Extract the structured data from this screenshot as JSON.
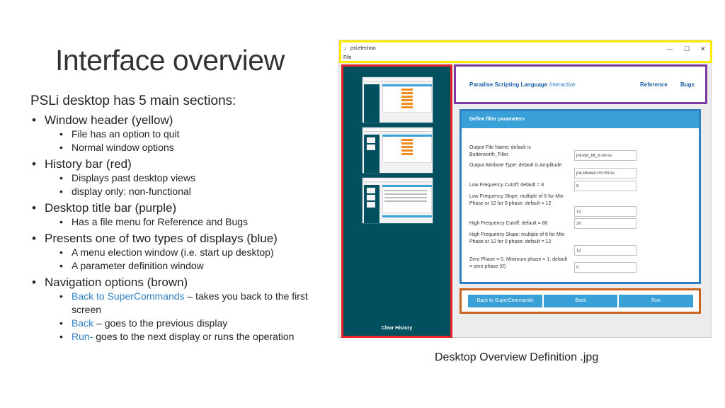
{
  "slide": {
    "title": "Interface overview",
    "intro": "PSLi desktop has 5 main sections:",
    "sections": [
      {
        "label": "Window header (yellow)",
        "items": [
          "File has an option to quit",
          "Normal window options"
        ]
      },
      {
        "label": "History bar (red)",
        "items": [
          "Displays past desktop views",
          "display only: non-functional"
        ]
      },
      {
        "label": "Desktop title bar (purple)",
        "items": [
          "Has a file menu for Reference and Bugs"
        ]
      },
      {
        "label": "Presents one of two types of displays (blue)",
        "items": [
          "A menu election window (i.e. start up desktop)",
          "A parameter definition window"
        ]
      },
      {
        "label": "Navigation options (brown)",
        "nav_items": [
          {
            "link": "Back to SuperCommands",
            "rest": " – takes you back to the first screen"
          },
          {
            "link": "Back",
            "rest": " – goes to the previous display"
          },
          {
            "link": "Run-",
            "rest": " goes to the next display or runs the operation"
          }
        ]
      }
    ],
    "caption": "Desktop Overview Definition .jpg"
  },
  "screenshot": {
    "window": {
      "title": "psl.electron",
      "menu": "File",
      "minimize": "—",
      "maximize": "☐",
      "close": "✕"
    },
    "history": {
      "clear_label": "Clear History"
    },
    "title_bar": {
      "app_name": "Paradise Scripting Language",
      "app_mode": "Interactive",
      "menu_reference": "Reference",
      "menu_bugs": "Bugs"
    },
    "panel": {
      "title": "Define filter parameters",
      "fields": [
        {
          "label": "Output File Name: default is Butterworth_Filter",
          "value": "jnk-bw_filt_8-30-ss"
        },
        {
          "label": "Output Attribute Type: default is Amplitude",
          "value": "jnk-filtered PSTM-ss"
        },
        {
          "label": "Low Frequency Cutoff: default = 8",
          "value": "8"
        },
        {
          "label": "Low Frequency Slope: multiple of 6 for Min Phase or 12 for 0 phase: default = 12",
          "value": "12"
        },
        {
          "label": "High Frequency Cutoff: default = 80",
          "value": "30"
        },
        {
          "label": "High Frequency Slope: multiple of 6 for Min Phase or 12 for 0 phase: default = 12",
          "value": "12"
        },
        {
          "label": "Zero Phase = 0, Minimum phase = 1: default = zero phase (0)",
          "value": "0"
        }
      ]
    },
    "nav": {
      "back_super": "Back to SuperCommands",
      "back": "Back",
      "run": "Run"
    },
    "colors": {
      "header_outline": "#ffeb00",
      "history_outline": "#e8232a",
      "title_outline": "#7a3aa0",
      "display_outline": "#2f7fc1",
      "nav_outline": "#c8641e",
      "teal": "#005060",
      "accent": "#3aa0d8"
    }
  }
}
